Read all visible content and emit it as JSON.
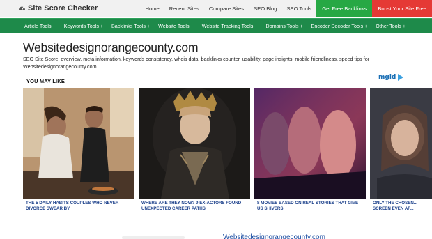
{
  "brand": {
    "name": "Site Score Checker",
    "icon": "gauge-icon"
  },
  "topnav": {
    "items": [
      "Home",
      "Recent Sites",
      "Compare Sites",
      "SEO Blog",
      "SEO Tools"
    ],
    "cta_green": "Get Free Backlinks",
    "cta_red": "Boost Your Site Free"
  },
  "tools": {
    "items": [
      "Article Tools",
      "Keywords Tools",
      "Backlinks Tools",
      "Website Tools",
      "Website Tracking Tools",
      "Domains Tools",
      "Encoder Decoder Tools",
      "Other Tools"
    ],
    "plus": "+"
  },
  "main": {
    "title": "Websitedesignorangecounty.com",
    "description": "SEO Site Score, overview, meta information, keywords consistency, whois data, backlinks counter, usability, page insights, mobile friendliness, speed tips for Websitedesignorangecounty.com"
  },
  "recommend": {
    "heading": "YOU MAY LIKE",
    "provider": "mgid",
    "cards": [
      {
        "caption": "THE 5 DAILY HABITS COUPLES WHO NEVER DIVORCE SWEAR BY"
      },
      {
        "caption": "WHERE ARE THEY NOW? 9 EX-ACTORS FOUND UNEXPECTED CAREER PATHS"
      },
      {
        "caption": "8 MOVIES BASED ON REAL STORIES THAT GIVE US SHIVERS"
      },
      {
        "caption": "ONLY THE CHOSEN... SCREEN EVEN AF..."
      }
    ]
  },
  "footer": {
    "teaser": "Websitedesignorangecounty.com"
  },
  "colors": {
    "topbar_bg": "#f1f1f1",
    "tools_bar": "#1e8a4a",
    "cta_green": "#27a844",
    "cta_red": "#e53935",
    "caption_blue": "#1a3f8a",
    "mgid_blue": "#1a6fb5"
  }
}
